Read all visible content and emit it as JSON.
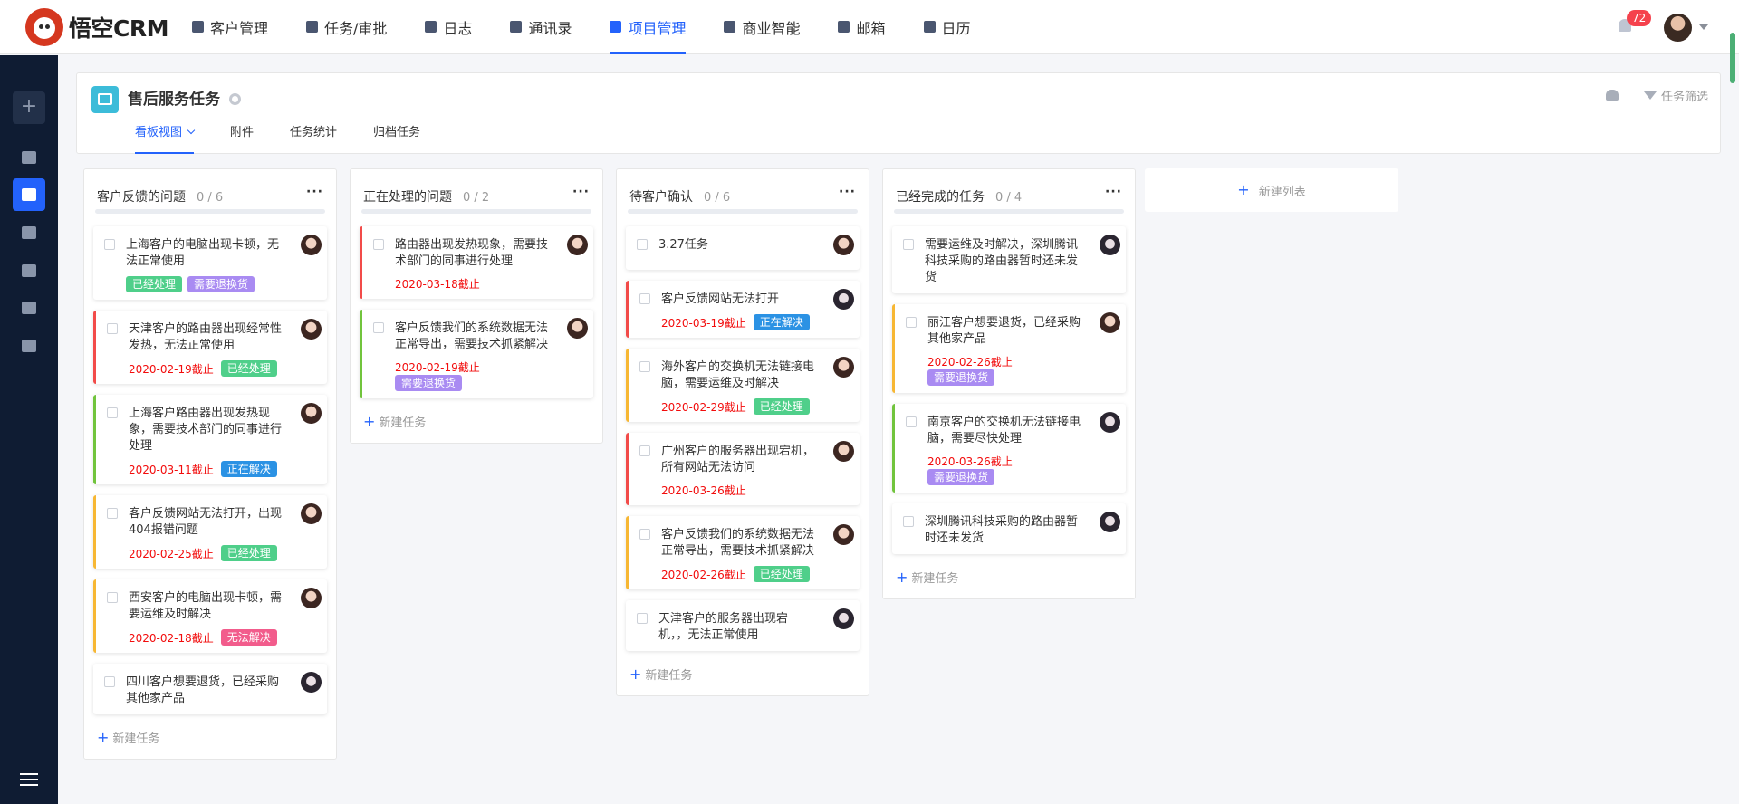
{
  "app": {
    "logo_text": "悟空CRM"
  },
  "nav": [
    {
      "label": "客户管理",
      "icon": "customer-icon"
    },
    {
      "label": "任务/审批",
      "icon": "task-icon"
    },
    {
      "label": "日志",
      "icon": "log-icon"
    },
    {
      "label": "通讯录",
      "icon": "contacts-icon"
    },
    {
      "label": "项目管理",
      "icon": "project-icon",
      "active": true
    },
    {
      "label": "商业智能",
      "icon": "bi-icon"
    },
    {
      "label": "邮箱",
      "icon": "mail-icon"
    },
    {
      "label": "日历",
      "icon": "calendar-icon"
    }
  ],
  "notifications": {
    "count": "72"
  },
  "project": {
    "title": "售后服务任务",
    "filter_label": "任务筛选",
    "tabs": [
      "看板视图",
      "附件",
      "任务统计",
      "归档任务"
    ],
    "active_tab": "看板视图"
  },
  "board": {
    "new_task_label": "新建任务",
    "new_list_label": "新建列表",
    "columns": [
      {
        "title": "客户反馈的问题",
        "count": "0 / 6",
        "cards": [
          {
            "text": "上海客户的电脑出现卡顿，无法正常使用",
            "due": "",
            "tags": [
              {
                "label": "已经处理",
                "color": "green"
              },
              {
                "label": "需要退换货",
                "color": "purple"
              }
            ],
            "border": "",
            "avatar": "female"
          },
          {
            "text": "天津客户的路由器出现经常性发热，无法正常使用",
            "due": "2020-02-19截止",
            "tags": [
              {
                "label": "已经处理",
                "color": "green"
              }
            ],
            "border": "red",
            "avatar": "female"
          },
          {
            "text": "上海客户路由器出现发热现象，需要技术部门的同事进行处理",
            "due": "2020-03-11截止",
            "tags": [
              {
                "label": "正在解决",
                "color": "blue"
              }
            ],
            "border": "green",
            "avatar": "female"
          },
          {
            "text": "客户反馈网站无法打开，出现404报错问题",
            "due": "2020-02-25截止",
            "tags": [
              {
                "label": "已经处理",
                "color": "green"
              }
            ],
            "border": "yellow",
            "avatar": "female"
          },
          {
            "text": "西安客户的电脑出现卡顿，需要运维及时解决",
            "due": "2020-02-18截止",
            "tags": [
              {
                "label": "无法解决",
                "color": "pink"
              }
            ],
            "border": "yellow",
            "avatar": "female"
          },
          {
            "text": "四川客户想要退货，已经采购其他家产品",
            "due": "",
            "tags": [],
            "border": "",
            "avatar": "female2"
          }
        ]
      },
      {
        "title": "正在处理的问题",
        "count": "0 / 2",
        "cards": [
          {
            "text": "路由器出现发热现象，需要技术部门的同事进行处理",
            "due": "2020-03-18截止",
            "tags": [],
            "border": "red",
            "avatar": "female"
          },
          {
            "text": "客户反馈我们的系统数据无法正常导出，需要技术抓紧解决",
            "due": "2020-02-19截止",
            "tags": [
              {
                "label": "需要退换货",
                "color": "purple"
              }
            ],
            "border": "green",
            "avatar": "female"
          }
        ]
      },
      {
        "title": "待客户确认",
        "count": "0 / 6",
        "cards": [
          {
            "text": "3.27任务",
            "due": "",
            "tags": [],
            "border": "",
            "avatar": "female"
          },
          {
            "text": "客户反馈网站无法打开",
            "due": "2020-03-19截止",
            "tags": [
              {
                "label": "正在解决",
                "color": "blue"
              }
            ],
            "border": "red",
            "avatar": "female2"
          },
          {
            "text": "海外客户的交换机无法链接电脑，需要运维及时解决",
            "due": "2020-02-29截止",
            "tags": [
              {
                "label": "已经处理",
                "color": "green"
              }
            ],
            "border": "yellow",
            "avatar": "female"
          },
          {
            "text": "广州客户的服务器出现宕机，所有网站无法访问",
            "due": "2020-03-26截止",
            "tags": [],
            "border": "red",
            "avatar": "female"
          },
          {
            "text": "客户反馈我们的系统数据无法正常导出，需要技术抓紧解决",
            "due": "2020-02-26截止",
            "tags": [
              {
                "label": "已经处理",
                "color": "green"
              }
            ],
            "border": "yellow",
            "avatar": "female"
          },
          {
            "text": "天津客户的服务器出现宕机，，无法正常使用",
            "due": "",
            "tags": [],
            "border": "",
            "avatar": "female2"
          }
        ]
      },
      {
        "title": "已经完成的任务",
        "count": "0 / 4",
        "cards": [
          {
            "text": "需要运维及时解决，深圳腾讯科技采购的路由器暂时还未发货",
            "due": "",
            "tags": [],
            "border": "",
            "avatar": "female2"
          },
          {
            "text": "丽江客户想要退货，已经采购其他家产品",
            "due": "2020-02-26截止",
            "tags": [
              {
                "label": "需要退换货",
                "color": "purple"
              }
            ],
            "border": "yellow",
            "avatar": "female"
          },
          {
            "text": "南京客户的交换机无法链接电脑，需要尽快处理",
            "due": "2020-03-26截止",
            "tags": [
              {
                "label": "需要退换货",
                "color": "purple"
              }
            ],
            "border": "green",
            "avatar": "female2"
          },
          {
            "text": "深圳腾讯科技采购的路由器暂时还未发货",
            "due": "",
            "tags": [],
            "border": "",
            "avatar": "female2"
          }
        ]
      }
    ]
  }
}
